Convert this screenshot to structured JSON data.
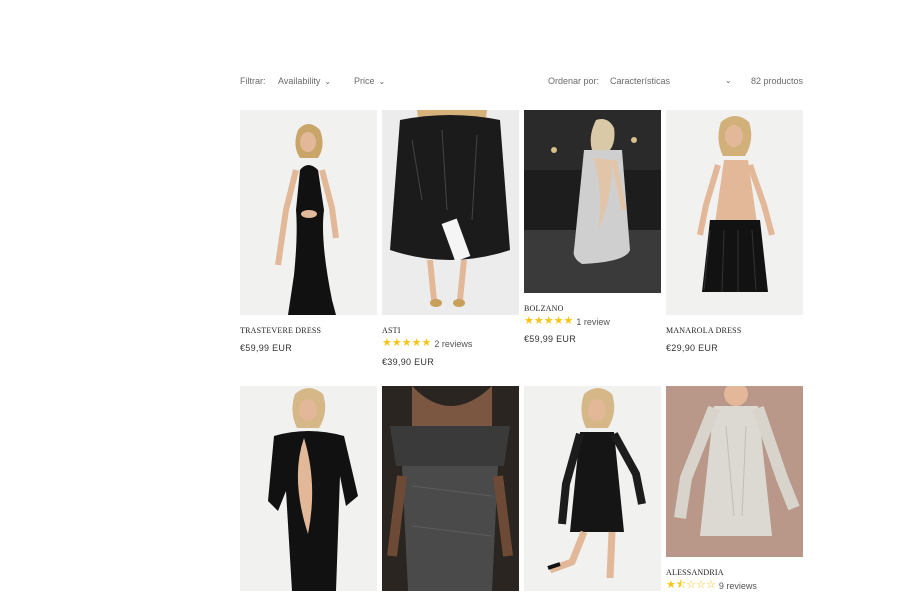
{
  "filters": {
    "filter_label": "Filtrar:",
    "availability": "Availability",
    "price": "Price",
    "sort_label": "Ordenar por:",
    "sort_value": "Características",
    "count": "82 productos"
  },
  "products": [
    {
      "title": "TRASTEVERE DRESS",
      "price": "€59,99 EUR",
      "reviews": "",
      "rating": 0
    },
    {
      "title": "ASTI",
      "price": "€39,90 EUR",
      "reviews": "2 reviews",
      "rating": 5
    },
    {
      "title": "BOLZANO",
      "price": "€59,99 EUR",
      "reviews": "1 review",
      "rating": 5
    },
    {
      "title": "MANAROLA DRESS",
      "price": "€29,90 EUR",
      "reviews": "",
      "rating": 0
    },
    {
      "title": "",
      "price": "",
      "reviews": "",
      "rating": 0
    },
    {
      "title": "",
      "price": "",
      "reviews": "",
      "rating": 0
    },
    {
      "title": "",
      "price": "",
      "reviews": "",
      "rating": 0
    },
    {
      "title": "ALESSANDRIA",
      "price": "",
      "reviews": "9 reviews",
      "rating": 1.5
    }
  ],
  "colors": {
    "star": "#f5c518",
    "text": "#222222",
    "muted": "#6a6a6a"
  }
}
